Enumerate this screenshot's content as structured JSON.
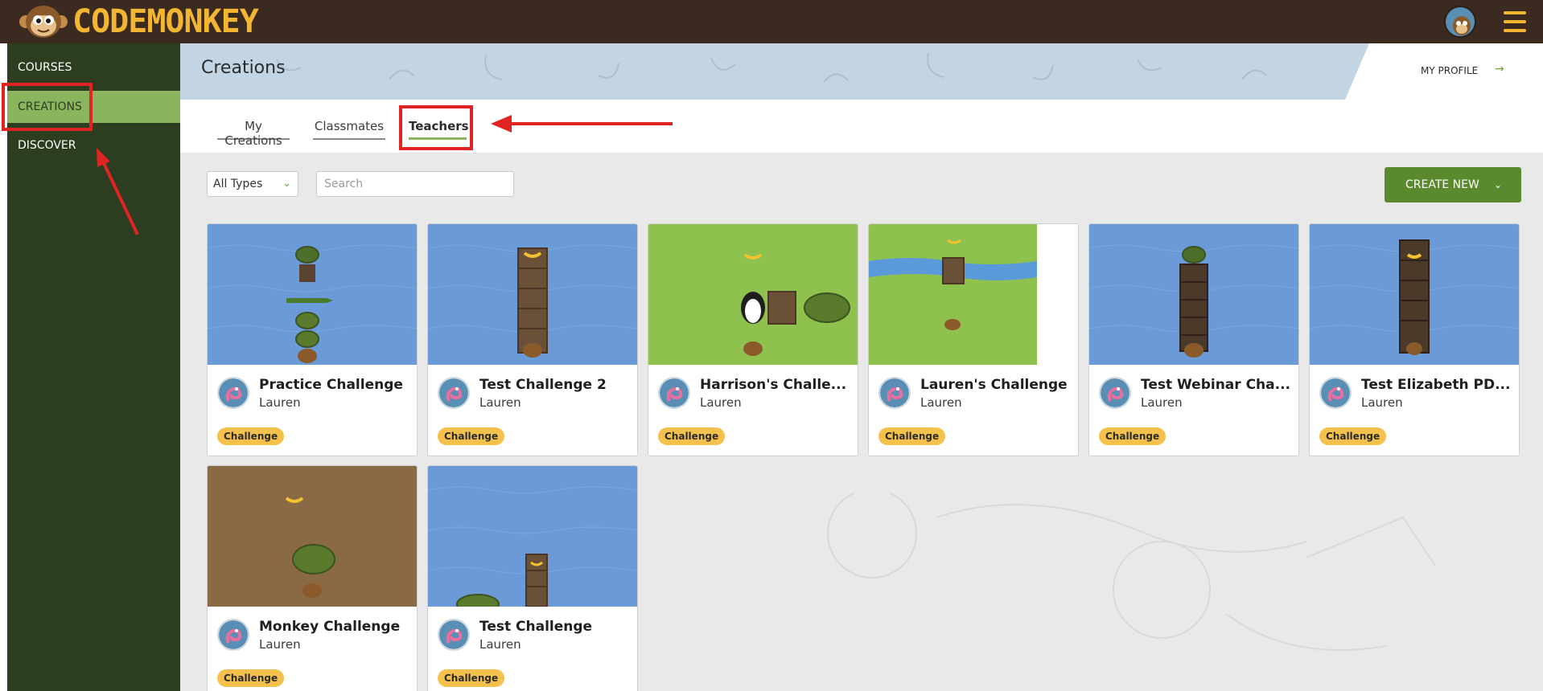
{
  "app": {
    "logo_text": "CODEMONKEY"
  },
  "sidebar": {
    "items": [
      {
        "label": "COURSES"
      },
      {
        "label": "CREATIONS"
      },
      {
        "label": "DISCOVER"
      }
    ]
  },
  "header": {
    "title": "Creations",
    "profile_link": "MY PROFILE"
  },
  "tabs": [
    {
      "label": "My Creations"
    },
    {
      "label": "Classmates"
    },
    {
      "label": "Teachers"
    }
  ],
  "filters": {
    "type_select": "All Types",
    "search_placeholder": "Search",
    "create_label": "CREATE NEW"
  },
  "cards": [
    {
      "title": "Practice Challenge",
      "author": "Lauren",
      "badge": "Challenge"
    },
    {
      "title": "Test Challenge 2",
      "author": "Lauren",
      "badge": "Challenge"
    },
    {
      "title": "Harrison's Challe...",
      "author": "Lauren",
      "badge": "Challenge"
    },
    {
      "title": "Lauren's Challenge",
      "author": "Lauren",
      "badge": "Challenge"
    },
    {
      "title": "Test Webinar Cha...",
      "author": "Lauren",
      "badge": "Challenge"
    },
    {
      "title": "Test Elizabeth PD...",
      "author": "Lauren",
      "badge": "Challenge"
    },
    {
      "title": "Monkey Challenge",
      "author": "Lauren",
      "badge": "Challenge"
    },
    {
      "title": "Test Challenge",
      "author": "Lauren",
      "badge": "Challenge"
    }
  ],
  "colors": {
    "topbar": "#3b2a20",
    "sidebar": "#2d3d1f",
    "sidebar_active": "#8bb45e",
    "accent_green": "#5b8a2e",
    "logo_yellow": "#f2b632",
    "badge_yellow": "#f5c14d",
    "annotation_red": "#e02424"
  }
}
